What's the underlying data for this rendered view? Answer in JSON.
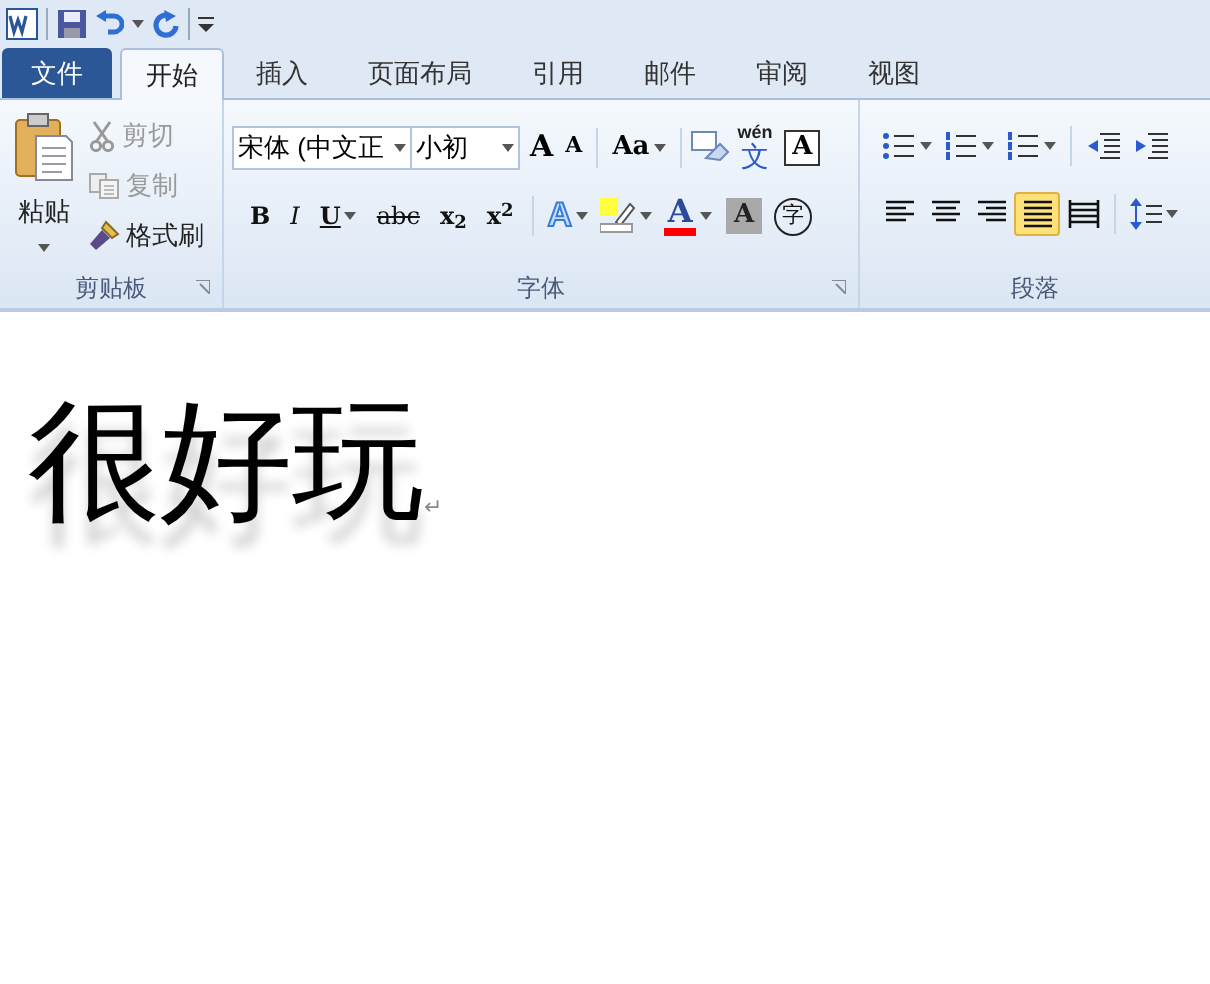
{
  "tabs": [
    {
      "label": "文件",
      "kind": "file",
      "selected": false
    },
    {
      "label": "开始",
      "kind": "tab",
      "selected": true
    },
    {
      "label": "插入",
      "kind": "tab",
      "selected": false
    },
    {
      "label": "页面布局",
      "kind": "tab",
      "selected": false
    },
    {
      "label": "引用",
      "kind": "tab",
      "selected": false
    },
    {
      "label": "邮件",
      "kind": "tab",
      "selected": false
    },
    {
      "label": "审阅",
      "kind": "tab",
      "selected": false
    },
    {
      "label": "视图",
      "kind": "tab",
      "selected": false
    }
  ],
  "clipboard": {
    "paste": "粘贴",
    "items": [
      {
        "kind": "cut",
        "label": "剪切",
        "disabled": true
      },
      {
        "kind": "copy",
        "label": "复制",
        "disabled": true
      },
      {
        "kind": "painter",
        "label": "格式刷",
        "disabled": false
      }
    ],
    "group_label": "剪贴板"
  },
  "font": {
    "font_name": "宋体 (中文正",
    "font_size": "小初",
    "grow": "A",
    "shrink": "A",
    "change_case": "Aa",
    "phonetic_top": "wén",
    "phonetic_bottom": "文",
    "char_border": "A",
    "format_buttons": [
      {
        "kind": "bold",
        "label": "B"
      },
      {
        "kind": "italic",
        "label": "I"
      },
      {
        "kind": "underline",
        "label": "U"
      },
      {
        "kind": "strike",
        "label": "abc"
      },
      {
        "kind": "sub",
        "label": "x$_{2}$"
      },
      {
        "kind": "sup",
        "label": "x$^{2}$"
      }
    ],
    "effects": "A",
    "font_color": "A",
    "shading": "A",
    "enclose": "字",
    "group_label": "字体"
  },
  "paragraph": {
    "align_buttons": [
      {
        "kind": "left",
        "selected": false
      },
      {
        "kind": "center",
        "selected": false
      },
      {
        "kind": "right",
        "selected": false
      },
      {
        "kind": "justify",
        "selected": true
      },
      {
        "kind": "distributed",
        "selected": false
      }
    ],
    "group_label": "段落"
  },
  "document": {
    "text": "很好玩",
    "paragraph_mark": "↵"
  }
}
